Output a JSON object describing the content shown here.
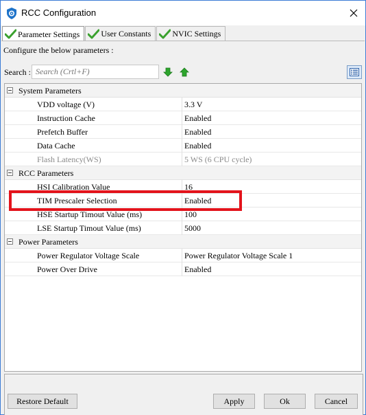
{
  "window": {
    "title": "RCC Configuration"
  },
  "tabs": [
    {
      "label": "Parameter Settings",
      "active": true
    },
    {
      "label": "User Constants",
      "active": false
    },
    {
      "label": "NVIC Settings",
      "active": false
    }
  ],
  "description": "Configure the below parameters :",
  "search": {
    "label": "Search :",
    "placeholder": "Search (Crtl+F)",
    "value": ""
  },
  "groups": [
    {
      "name": "System Parameters",
      "params": [
        {
          "name": "VDD voltage (V)",
          "value": "3.3 V",
          "enabled": true
        },
        {
          "name": "Instruction Cache",
          "value": "Enabled",
          "enabled": true
        },
        {
          "name": "Prefetch Buffer",
          "value": "Enabled",
          "enabled": true
        },
        {
          "name": "Data Cache",
          "value": "Enabled",
          "enabled": true
        },
        {
          "name": "Flash Latency(WS)",
          "value": "5 WS (6 CPU cycle)",
          "enabled": false
        }
      ]
    },
    {
      "name": "RCC Parameters",
      "params": [
        {
          "name": "HSI Calibration Value",
          "value": "16",
          "enabled": true
        },
        {
          "name": "TIM Prescaler Selection",
          "value": "Enabled",
          "enabled": true
        },
        {
          "name": "HSE Startup Timout Value (ms)",
          "value": "100",
          "enabled": true
        },
        {
          "name": "LSE Startup Timout Value (ms)",
          "value": "5000",
          "enabled": true
        }
      ]
    },
    {
      "name": "Power Parameters",
      "params": [
        {
          "name": "Power Regulator Voltage Scale",
          "value": "Power Regulator Voltage Scale 1",
          "enabled": true
        },
        {
          "name": "Power Over Drive",
          "value": "Enabled",
          "enabled": true
        }
      ]
    }
  ],
  "buttons": {
    "restore_default": "Restore Default",
    "apply": "Apply",
    "ok": "Ok",
    "cancel": "Cancel"
  },
  "colors": {
    "highlight": "#e3131b",
    "tab_check": "#3aa12e",
    "arrow_green": "#2da52d",
    "title_icon": "#1e73c9"
  },
  "icons": {
    "app": "shield-icon",
    "close": "close-icon",
    "tab_status": "check-icon",
    "search_next": "arrow-down-icon",
    "search_prev": "arrow-up-icon",
    "view_toggle": "list-view-icon"
  }
}
